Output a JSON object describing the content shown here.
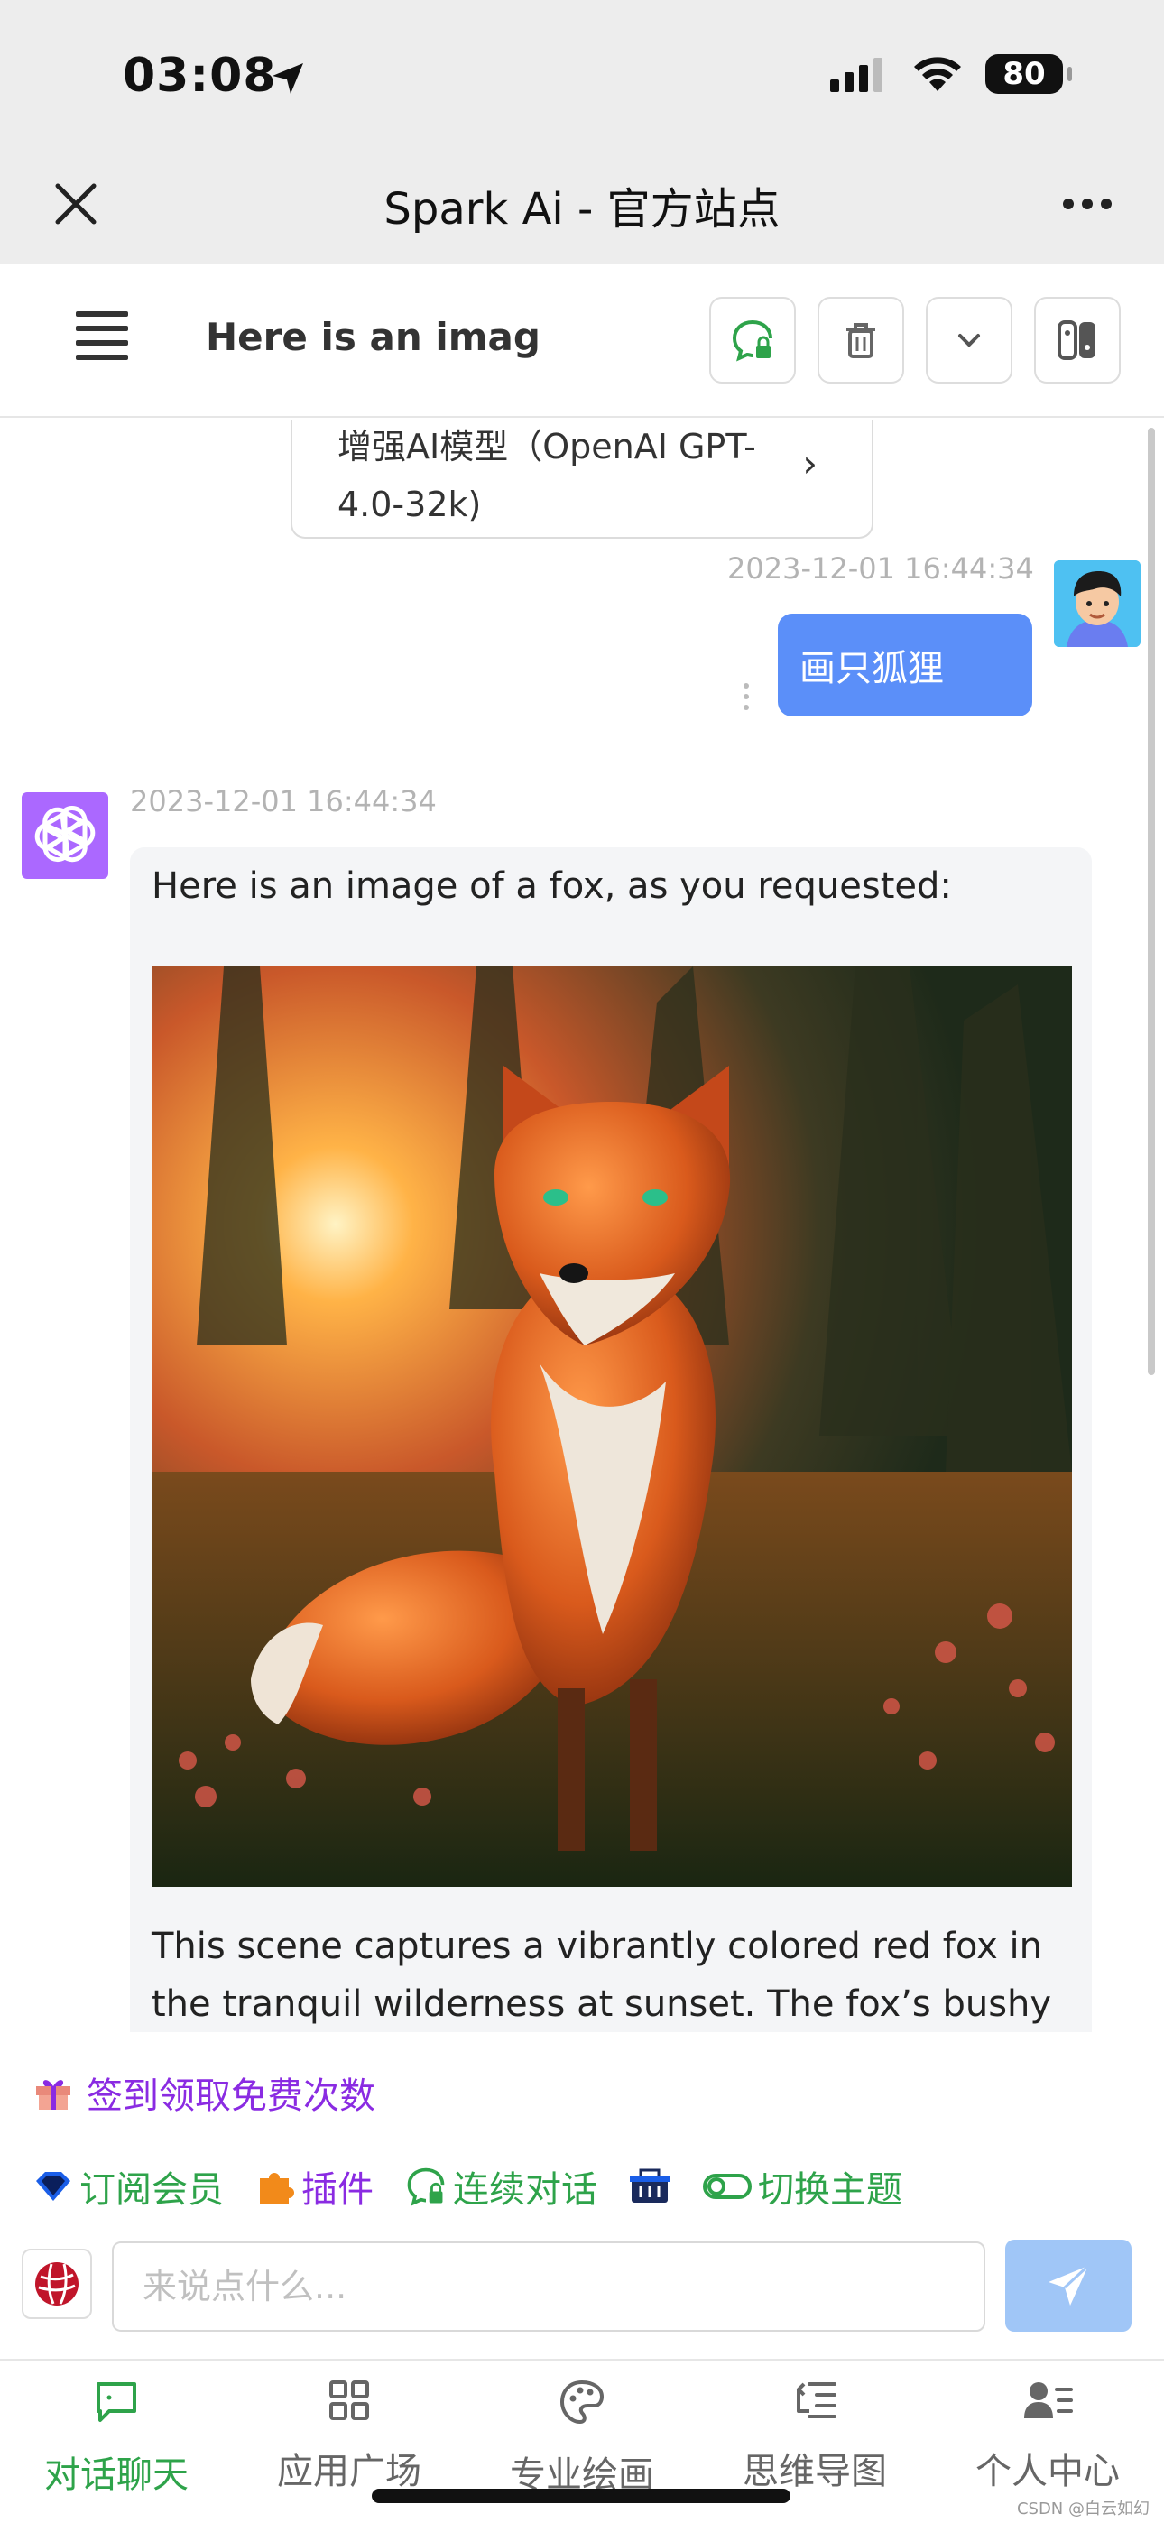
{
  "status_bar": {
    "time": "03:08",
    "battery": "80"
  },
  "nav": {
    "title": "Spark Ai - 官方站点"
  },
  "header": {
    "chat_title": "Here is an imag"
  },
  "model_card": {
    "text": "增强AI模型（OpenAI GPT-4.0-32k)"
  },
  "messages": {
    "user": {
      "timestamp": "2023-12-01 16:44:34",
      "text": "画只狐狸"
    },
    "bot": {
      "timestamp": "2023-12-01 16:44:34",
      "text1": "Here is an image of a fox, as you requested:",
      "text2": "This scene captures a vibrantly colored red fox in the tranquil wilderness at sunset. The fox’s bushy"
    }
  },
  "toolbar": {
    "signin": "签到领取免费次数",
    "subscribe": "订阅会员",
    "plugins": "插件",
    "continuous": "连续对话",
    "switch_theme": "切换主题"
  },
  "input": {
    "placeholder": "来说点什么..."
  },
  "tabs": [
    {
      "label": "对话聊天"
    },
    {
      "label": "应用广场"
    },
    {
      "label": "专业绘画"
    },
    {
      "label": "思维导图"
    },
    {
      "label": "个人中心"
    }
  ],
  "watermark": "CSDN @白云如幻",
  "colors": {
    "accent": "#5b8ff9",
    "tab_active": "#2ea34a",
    "signin": "#8a2be2",
    "bot_avatar": "#ab68ff"
  }
}
